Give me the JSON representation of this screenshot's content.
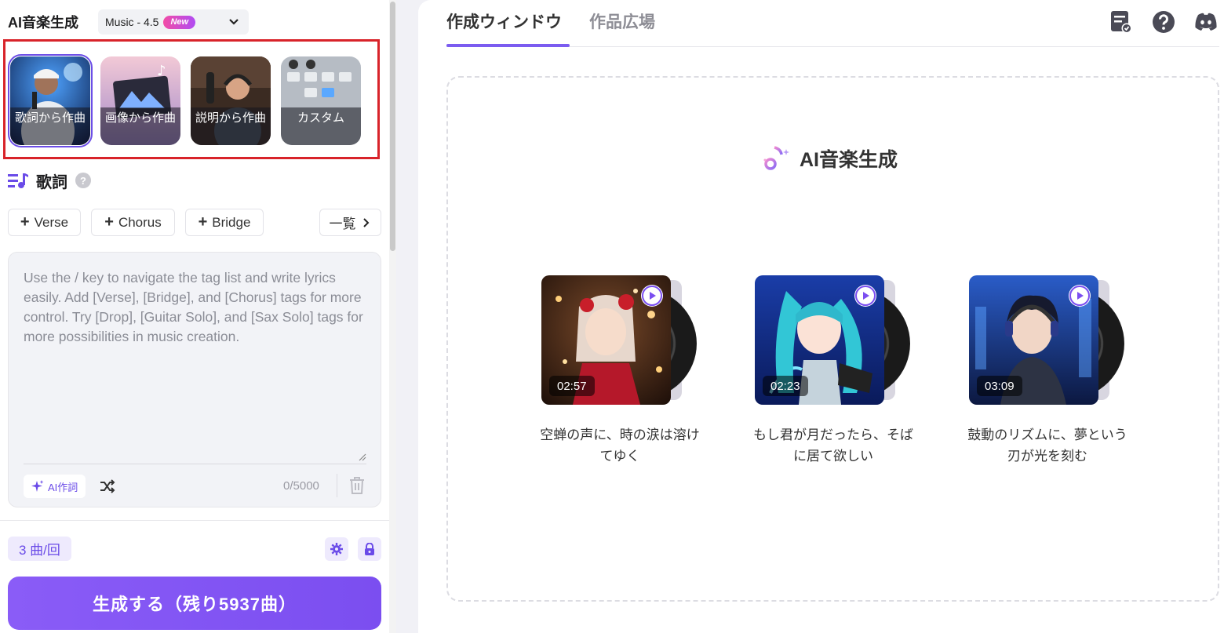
{
  "header": {
    "title": "AI音楽生成",
    "model": {
      "name": "Music - 4.5",
      "badge": "New"
    }
  },
  "modes": [
    {
      "label": "歌詞から作曲",
      "active": true
    },
    {
      "label": "画像から作曲",
      "active": false
    },
    {
      "label": "説明から作曲",
      "active": false
    },
    {
      "label": "カスタム",
      "active": false
    }
  ],
  "lyrics": {
    "title": "歌詞",
    "help": "?",
    "tags": [
      "Verse",
      "Chorus",
      "Bridge"
    ],
    "list_button": "一覧",
    "placeholder": "Use the / key to navigate the tag list and write lyrics easily. Add [Verse], [Bridge], and [Chorus] tags for more control. Try [Drop], [Guitar Solo], and [Sax Solo] tags for more possibilities in music creation.",
    "ai_button": "AI作詞",
    "char_count": "0/5000"
  },
  "footer": {
    "count": "3 曲/回",
    "generate": "生成する（残り5937曲）"
  },
  "tabs": {
    "active": "作成ウィンドウ",
    "inactive": "作品広場"
  },
  "canvas": {
    "title": "AI音楽生成",
    "songs": [
      {
        "duration": "02:57",
        "title": "空蝉の声に、時の涙は溶けてゆく"
      },
      {
        "duration": "02:23",
        "title": "もし君が月だったら、そばに居て欲しい"
      },
      {
        "duration": "03:09",
        "title": "鼓動のリズムに、夢という刃が光を刻む"
      }
    ]
  },
  "colors": {
    "accent": "#7b4ef0",
    "highlight_box": "#d8232a"
  },
  "icons": [
    "chevron-down-icon",
    "lyrics-icon",
    "help-icon",
    "plus-icon",
    "chevron-right-icon",
    "sparkle-icon",
    "shuffle-icon",
    "trash-icon",
    "gear-icon",
    "lock-icon",
    "task-list-icon",
    "question-icon",
    "discord-icon",
    "music-note-icon",
    "play-icon"
  ]
}
